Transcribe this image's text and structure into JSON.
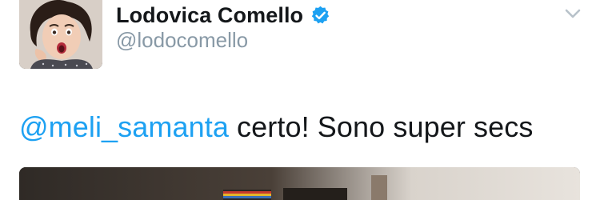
{
  "user": {
    "display_name": "Lodovica Comello",
    "handle": "@lodocomello",
    "verified": true
  },
  "tweet": {
    "mention": "@meli_samanta",
    "text": " certo! Sono super secs"
  },
  "icons": {
    "verified": "verified-badge-icon",
    "menu": "chevron-down-icon"
  },
  "colors": {
    "link": "#1da1f2",
    "name": "#14171a",
    "handle": "#8899a6",
    "verified": "#1da1f2"
  }
}
